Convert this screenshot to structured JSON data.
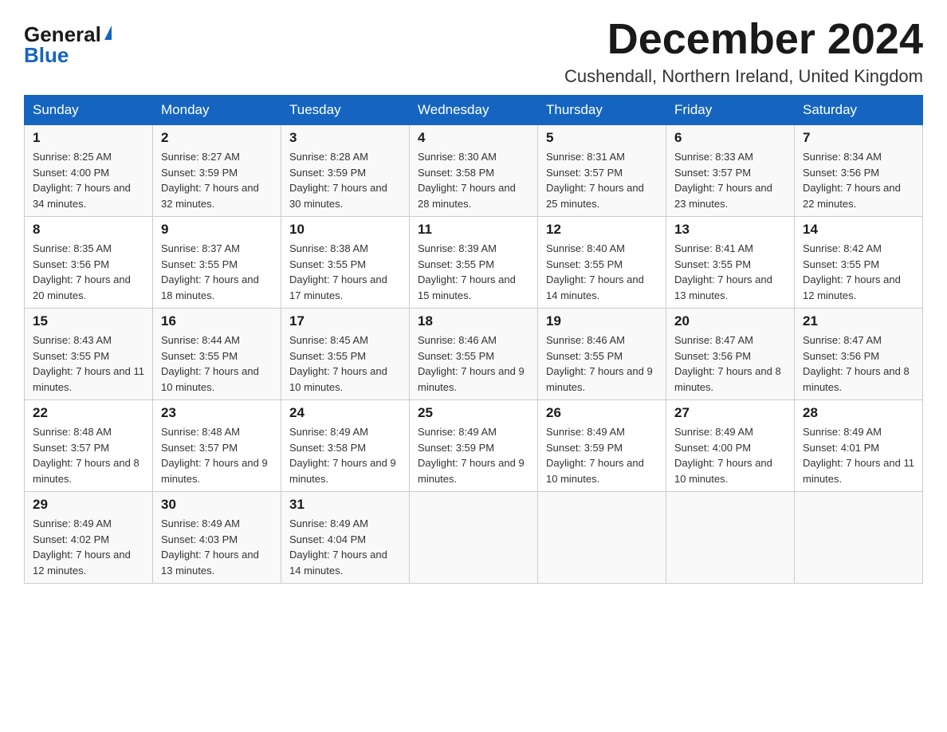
{
  "logo": {
    "general": "General",
    "blue": "Blue"
  },
  "title": "December 2024",
  "location": "Cushendall, Northern Ireland, United Kingdom",
  "days_of_week": [
    "Sunday",
    "Monday",
    "Tuesday",
    "Wednesday",
    "Thursday",
    "Friday",
    "Saturday"
  ],
  "weeks": [
    [
      {
        "day": "1",
        "sunrise": "8:25 AM",
        "sunset": "4:00 PM",
        "daylight": "7 hours and 34 minutes."
      },
      {
        "day": "2",
        "sunrise": "8:27 AM",
        "sunset": "3:59 PM",
        "daylight": "7 hours and 32 minutes."
      },
      {
        "day": "3",
        "sunrise": "8:28 AM",
        "sunset": "3:59 PM",
        "daylight": "7 hours and 30 minutes."
      },
      {
        "day": "4",
        "sunrise": "8:30 AM",
        "sunset": "3:58 PM",
        "daylight": "7 hours and 28 minutes."
      },
      {
        "day": "5",
        "sunrise": "8:31 AM",
        "sunset": "3:57 PM",
        "daylight": "7 hours and 25 minutes."
      },
      {
        "day": "6",
        "sunrise": "8:33 AM",
        "sunset": "3:57 PM",
        "daylight": "7 hours and 23 minutes."
      },
      {
        "day": "7",
        "sunrise": "8:34 AM",
        "sunset": "3:56 PM",
        "daylight": "7 hours and 22 minutes."
      }
    ],
    [
      {
        "day": "8",
        "sunrise": "8:35 AM",
        "sunset": "3:56 PM",
        "daylight": "7 hours and 20 minutes."
      },
      {
        "day": "9",
        "sunrise": "8:37 AM",
        "sunset": "3:55 PM",
        "daylight": "7 hours and 18 minutes."
      },
      {
        "day": "10",
        "sunrise": "8:38 AM",
        "sunset": "3:55 PM",
        "daylight": "7 hours and 17 minutes."
      },
      {
        "day": "11",
        "sunrise": "8:39 AM",
        "sunset": "3:55 PM",
        "daylight": "7 hours and 15 minutes."
      },
      {
        "day": "12",
        "sunrise": "8:40 AM",
        "sunset": "3:55 PM",
        "daylight": "7 hours and 14 minutes."
      },
      {
        "day": "13",
        "sunrise": "8:41 AM",
        "sunset": "3:55 PM",
        "daylight": "7 hours and 13 minutes."
      },
      {
        "day": "14",
        "sunrise": "8:42 AM",
        "sunset": "3:55 PM",
        "daylight": "7 hours and 12 minutes."
      }
    ],
    [
      {
        "day": "15",
        "sunrise": "8:43 AM",
        "sunset": "3:55 PM",
        "daylight": "7 hours and 11 minutes."
      },
      {
        "day": "16",
        "sunrise": "8:44 AM",
        "sunset": "3:55 PM",
        "daylight": "7 hours and 10 minutes."
      },
      {
        "day": "17",
        "sunrise": "8:45 AM",
        "sunset": "3:55 PM",
        "daylight": "7 hours and 10 minutes."
      },
      {
        "day": "18",
        "sunrise": "8:46 AM",
        "sunset": "3:55 PM",
        "daylight": "7 hours and 9 minutes."
      },
      {
        "day": "19",
        "sunrise": "8:46 AM",
        "sunset": "3:55 PM",
        "daylight": "7 hours and 9 minutes."
      },
      {
        "day": "20",
        "sunrise": "8:47 AM",
        "sunset": "3:56 PM",
        "daylight": "7 hours and 8 minutes."
      },
      {
        "day": "21",
        "sunrise": "8:47 AM",
        "sunset": "3:56 PM",
        "daylight": "7 hours and 8 minutes."
      }
    ],
    [
      {
        "day": "22",
        "sunrise": "8:48 AM",
        "sunset": "3:57 PM",
        "daylight": "7 hours and 8 minutes."
      },
      {
        "day": "23",
        "sunrise": "8:48 AM",
        "sunset": "3:57 PM",
        "daylight": "7 hours and 9 minutes."
      },
      {
        "day": "24",
        "sunrise": "8:49 AM",
        "sunset": "3:58 PM",
        "daylight": "7 hours and 9 minutes."
      },
      {
        "day": "25",
        "sunrise": "8:49 AM",
        "sunset": "3:59 PM",
        "daylight": "7 hours and 9 minutes."
      },
      {
        "day": "26",
        "sunrise": "8:49 AM",
        "sunset": "3:59 PM",
        "daylight": "7 hours and 10 minutes."
      },
      {
        "day": "27",
        "sunrise": "8:49 AM",
        "sunset": "4:00 PM",
        "daylight": "7 hours and 10 minutes."
      },
      {
        "day": "28",
        "sunrise": "8:49 AM",
        "sunset": "4:01 PM",
        "daylight": "7 hours and 11 minutes."
      }
    ],
    [
      {
        "day": "29",
        "sunrise": "8:49 AM",
        "sunset": "4:02 PM",
        "daylight": "7 hours and 12 minutes."
      },
      {
        "day": "30",
        "sunrise": "8:49 AM",
        "sunset": "4:03 PM",
        "daylight": "7 hours and 13 minutes."
      },
      {
        "day": "31",
        "sunrise": "8:49 AM",
        "sunset": "4:04 PM",
        "daylight": "7 hours and 14 minutes."
      },
      null,
      null,
      null,
      null
    ]
  ]
}
